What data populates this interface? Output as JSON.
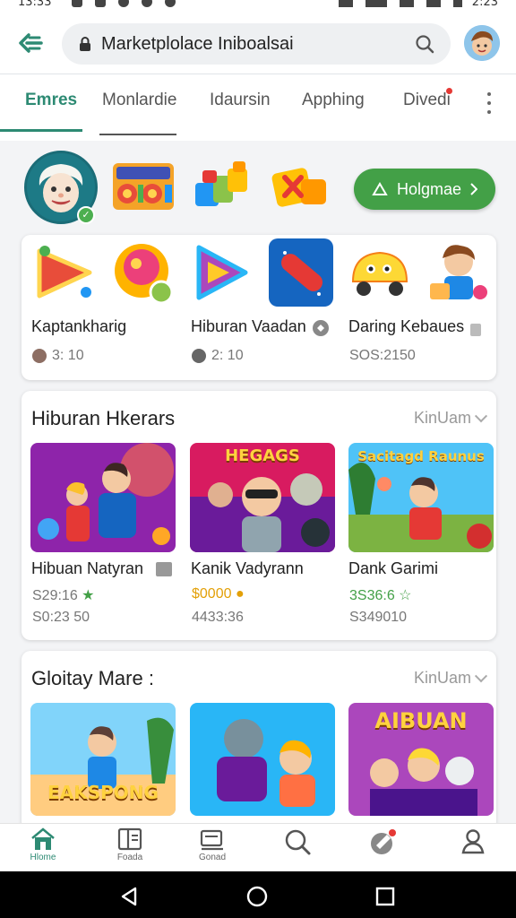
{
  "status_bar": {
    "time": "13:33",
    "time_right": "2:23"
  },
  "search": {
    "query": "Marketplolace Iniboalsai"
  },
  "tabs": [
    {
      "label": "Emres",
      "active": true
    },
    {
      "label": "Monlardie",
      "active": false
    },
    {
      "label": "Idaursin",
      "active": false
    },
    {
      "label": "Apphing",
      "active": false
    },
    {
      "label": "Divedi",
      "active": false
    }
  ],
  "featured": {
    "button_label": "Holgmae"
  },
  "top_row": {
    "items": [
      {
        "title": "Kaptankharig",
        "meta": "3: 10"
      },
      {
        "title": "Hiburan Vaadan",
        "meta": "2: 10"
      },
      {
        "title": "Daring Kebaues",
        "meta": "SOS:2150"
      }
    ]
  },
  "section1": {
    "title": "Hiburan Hkerars",
    "link": "KinUam",
    "games": [
      {
        "title": "Hibuan Natyran",
        "price": "S29:16",
        "sub": "S0:23 50",
        "thumb_label": ""
      },
      {
        "title": "Kanik Vadyrann",
        "price": "$0000",
        "sub": "4433:36",
        "thumb_label": "HEGAGS"
      },
      {
        "title": "Dank Garimi",
        "price": "3S36:6",
        "sub": "S349010",
        "thumb_label": "Sacitagd Raunus"
      }
    ]
  },
  "section2": {
    "title": "Gloitay Mare :",
    "link": "KinUam",
    "games": [
      {
        "thumb_label": "EAKSPONG"
      },
      {
        "thumb_label": ""
      },
      {
        "thumb_label": "AIBUAN"
      }
    ]
  },
  "bottom_nav": [
    {
      "label": "Hlome",
      "active": true
    },
    {
      "label": "Foada",
      "active": false
    },
    {
      "label": "Gonad",
      "active": false
    },
    {
      "label": "",
      "active": false
    },
    {
      "label": "",
      "active": false
    },
    {
      "label": "",
      "active": false
    }
  ],
  "colors": {
    "accent": "#2d8a73",
    "primary_button": "#43a047",
    "badge": "#e53935"
  }
}
